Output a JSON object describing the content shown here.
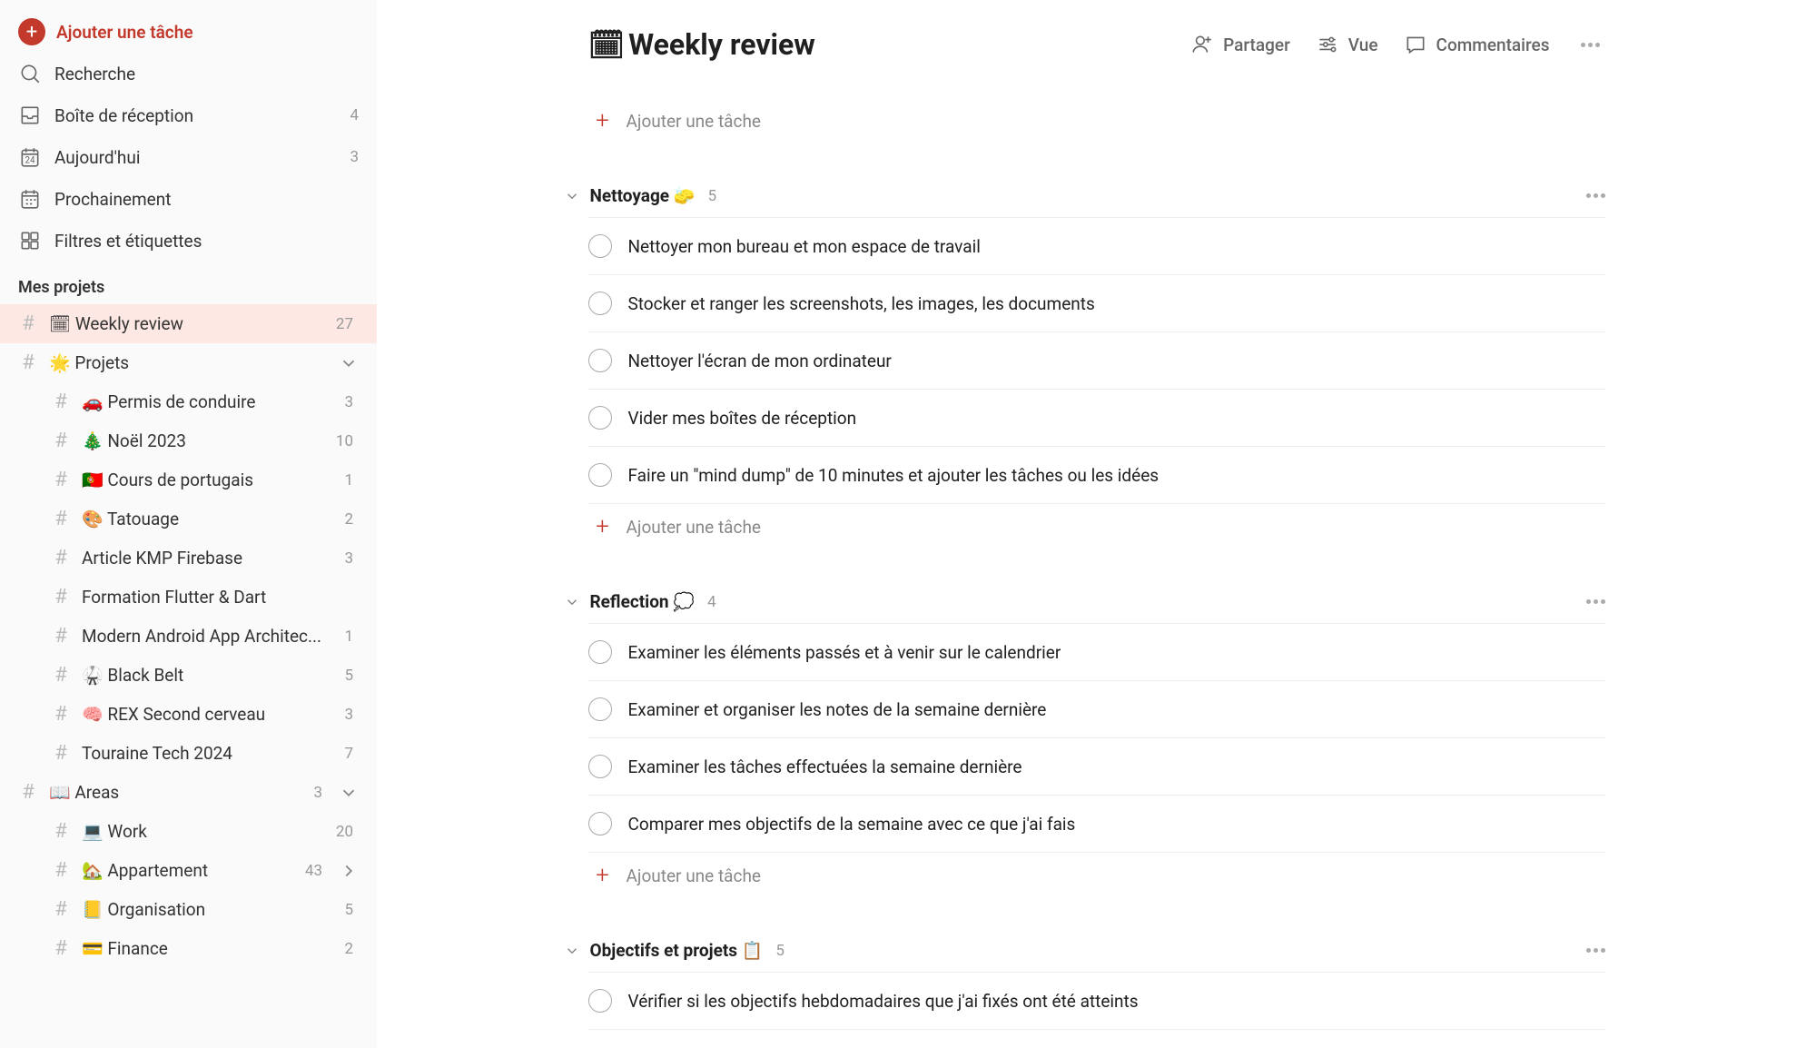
{
  "sidebar": {
    "add_task": "Ajouter une tâche",
    "nav": [
      {
        "key": "search",
        "label": "Recherche",
        "count": ""
      },
      {
        "key": "inbox",
        "label": "Boîte de réception",
        "count": "4"
      },
      {
        "key": "today",
        "label": "Aujourd'hui",
        "count": "3"
      },
      {
        "key": "upcoming",
        "label": "Prochainement",
        "count": ""
      },
      {
        "key": "filters",
        "label": "Filtres et étiquettes",
        "count": ""
      }
    ],
    "projects_header": "Mes projets",
    "projects": [
      {
        "label": "🗓 Weekly review",
        "count": "27",
        "indent": false,
        "active": true,
        "collapsible": false
      },
      {
        "label": "🌟 Projets",
        "count": "",
        "indent": false,
        "active": false,
        "collapsible": true,
        "expanded": true
      },
      {
        "label": "🚗 Permis de conduire",
        "count": "3",
        "indent": true,
        "active": false,
        "collapsible": false
      },
      {
        "label": "🎄 Noël 2023",
        "count": "10",
        "indent": true,
        "active": false,
        "collapsible": false
      },
      {
        "label": "🇵🇹 Cours de portugais",
        "count": "1",
        "indent": true,
        "active": false,
        "collapsible": false
      },
      {
        "label": "🎨 Tatouage",
        "count": "2",
        "indent": true,
        "active": false,
        "collapsible": false
      },
      {
        "label": "Article KMP Firebase",
        "count": "3",
        "indent": true,
        "active": false,
        "collapsible": false
      },
      {
        "label": "Formation Flutter & Dart",
        "count": "",
        "indent": true,
        "active": false,
        "collapsible": false
      },
      {
        "label": "Modern Android App Architec...",
        "count": "1",
        "indent": true,
        "active": false,
        "collapsible": false
      },
      {
        "label": "🥋 Black Belt",
        "count": "5",
        "indent": true,
        "active": false,
        "collapsible": false
      },
      {
        "label": "🧠 REX Second cerveau",
        "count": "3",
        "indent": true,
        "active": false,
        "collapsible": false
      },
      {
        "label": "Touraine Tech 2024",
        "count": "7",
        "indent": true,
        "active": false,
        "collapsible": false
      },
      {
        "label": "📖 Areas",
        "count": "3",
        "indent": false,
        "active": false,
        "collapsible": true,
        "expanded": true
      },
      {
        "label": "💻 Work",
        "count": "20",
        "indent": true,
        "active": false,
        "collapsible": false
      },
      {
        "label": "🏡 Appartement",
        "count": "43",
        "indent": true,
        "active": false,
        "collapsible": true,
        "expanded": false
      },
      {
        "label": "📒 Organisation",
        "count": "5",
        "indent": true,
        "active": false,
        "collapsible": false
      },
      {
        "label": "💳 Finance",
        "count": "2",
        "indent": true,
        "active": false,
        "collapsible": false
      }
    ]
  },
  "header": {
    "title_icon": "🗓",
    "title": "Weekly review",
    "share": "Partager",
    "view": "Vue",
    "comments": "Commentaires"
  },
  "add_task_inline": "Ajouter une tâche",
  "sections": [
    {
      "title": "Nettoyage 🧽",
      "count": "5",
      "tasks": [
        "Nettoyer mon bureau et mon espace de travail",
        "Stocker et ranger les screenshots, les images, les documents",
        "Nettoyer l'écran de mon ordinateur",
        "Vider mes boîtes de réception",
        "Faire un \"mind dump\" de 10 minutes et ajouter les tâches ou les idées"
      ]
    },
    {
      "title": "Reflection 💭",
      "count": "4",
      "tasks": [
        "Examiner les éléments passés et à venir sur le calendrier",
        "Examiner et organiser les notes de la semaine dernière",
        "Examiner les tâches effectuées la semaine dernière",
        "Comparer mes objectifs de la semaine avec ce que j'ai fais"
      ]
    },
    {
      "title": "Objectifs et projets 📋",
      "count": "5",
      "tasks": [
        "Vérifier si les objectifs hebdomadaires que j'ai fixés ont été atteints"
      ]
    }
  ]
}
